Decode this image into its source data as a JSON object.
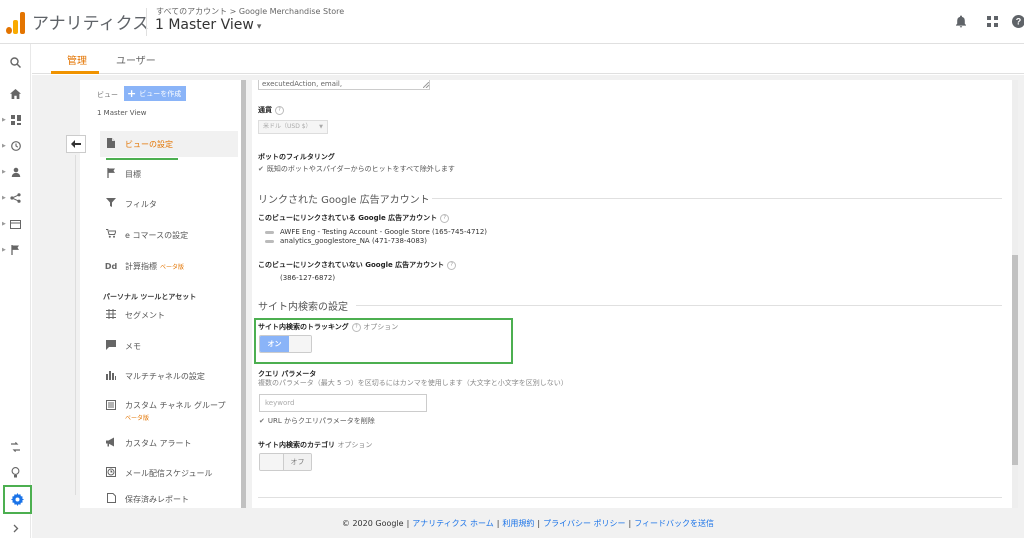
{
  "header": {
    "app_name": "アナリティクス",
    "breadcrumb_prefix": "すべてのアカウント",
    "breadcrumb_sep": ">",
    "breadcrumb_account": "Google Merchandise Store",
    "view_name": "1 Master View",
    "view_caret": "▾",
    "icons": [
      "bell-icon",
      "apps-icon",
      "help-icon"
    ]
  },
  "colors": {
    "accent_orange": "#e37400",
    "brand_blue": "#1a73e8",
    "highlight_green": "#4caf50",
    "toggle_blue": "#8ab4f8"
  },
  "tabs": [
    {
      "label": "管理",
      "active": true
    },
    {
      "label": "ユーザー",
      "active": false
    }
  ],
  "left_column": {
    "header_label": "ビュー",
    "create_button": "ビューを作成",
    "view_name": "1 Master View",
    "items": [
      {
        "label": "ビューの設定",
        "icon": "document-icon",
        "selected": true
      },
      {
        "label": "目標",
        "icon": "flag-icon"
      },
      {
        "label": "フィルタ",
        "icon": "filter-icon"
      },
      {
        "label": "e コマースの設定",
        "icon": "cart-icon"
      },
      {
        "label": "計算指標",
        "icon": "dd-icon",
        "beta": "ベータ版"
      }
    ],
    "section_label": "パーソナル ツールとアセット",
    "tool_items": [
      {
        "label": "セグメント",
        "icon": "segment-icon"
      },
      {
        "label": "メモ",
        "icon": "note-icon"
      },
      {
        "label": "マルチチャネルの設定",
        "icon": "bars-icon"
      },
      {
        "label": "カスタム チャネル グループ",
        "icon": "channel-group-icon",
        "beta": "ベータ版"
      },
      {
        "label": "カスタム アラート",
        "icon": "megaphone-icon"
      },
      {
        "label": "メール配信スケジュール",
        "icon": "clock-icon"
      },
      {
        "label": "保存済みレポート",
        "icon": "saved-report-icon"
      }
    ]
  },
  "settings": {
    "excluded_params_value": "executedAction, email,",
    "currency_label": "通貨",
    "currency_value": "米ドル（USD $）",
    "bot_filter_label": "ボットのフィルタリング",
    "bot_filter_checkbox": "既知のボットやスパイダーからのヒットをすべて除外します",
    "linked_ads_heading": "リンクされた Google 広告アカウント",
    "linked_to_view_label": "このビューにリンクされている Google 広告アカウント",
    "linked_accounts": [
      "AWFE Eng - Testing Account - Google Store (165-745-4712)",
      "analytics_googlestore_NA (471-738-4083)"
    ],
    "not_linked_label": "このビューにリンクされていない Google 広告アカウント",
    "not_linked_accounts": [
      "(386-127-6872)"
    ],
    "site_search_heading": "サイト内検索の設定",
    "tracking_label": "サイト内検索のトラッキング",
    "tracking_option": "オプション",
    "tracking_toggle": "オン",
    "query_param_label": "クエリ パラメータ",
    "query_param_help": "複数のパラメータ（最大 5 つ）を区切るにはカンマを使用します（大文字と小文字を区別しない）",
    "query_param_value": "keyword",
    "remove_param_checkbox": "URL からクエリパラメータを削除",
    "category_label": "サイト内検索のカテゴリ",
    "category_option": "オプション",
    "category_toggle": "オフ"
  },
  "footer": {
    "copyright": "© 2020 Google",
    "links": [
      "アナリティクス ホーム",
      "利用規約",
      "プライバシー ポリシー",
      "フィードバックを送信"
    ]
  }
}
